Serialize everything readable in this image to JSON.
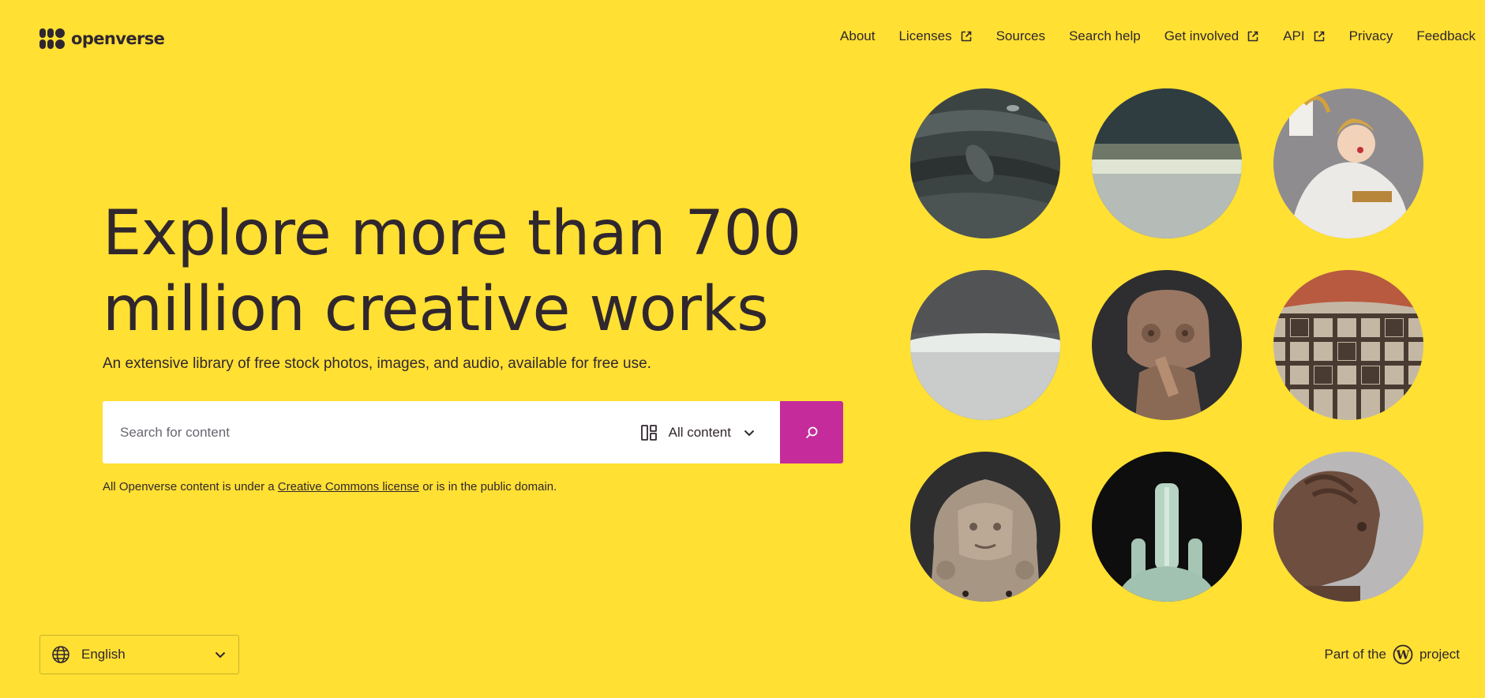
{
  "brand": {
    "name": "openverse"
  },
  "nav": {
    "items": [
      {
        "label": "About",
        "external": false
      },
      {
        "label": "Licenses",
        "external": true
      },
      {
        "label": "Sources",
        "external": false
      },
      {
        "label": "Search help",
        "external": false
      },
      {
        "label": "Get involved",
        "external": true
      },
      {
        "label": "API",
        "external": true
      },
      {
        "label": "Privacy",
        "external": false
      },
      {
        "label": "Feedback",
        "external": false
      }
    ]
  },
  "hero": {
    "headline_line1": "Explore more than 700",
    "headline_line2": "million creative works",
    "subtitle": "An extensive library of free stock photos, images, and audio, available for free use."
  },
  "search": {
    "placeholder": "Search for content",
    "content_type": "All content",
    "submit_icon": "search-icon"
  },
  "license_note": {
    "before": "All Openverse content is under a ",
    "link": "Creative Commons license",
    "after": " or is in the public domain."
  },
  "gallery": {
    "items": [
      "dark-stone-vessel",
      "celadon-bowl",
      "porcelain-figurine",
      "white-porcelain-bowl",
      "clay-figure",
      "painted-pottery-bowl",
      "stone-plaque-face",
      "celadon-vase",
      "clay-head"
    ]
  },
  "footer": {
    "language": "English",
    "wp_before": "Part of the",
    "wp_after": "project"
  },
  "colors": {
    "background": "#ffe033",
    "text": "#30272e",
    "accent": "#c52b9b"
  }
}
